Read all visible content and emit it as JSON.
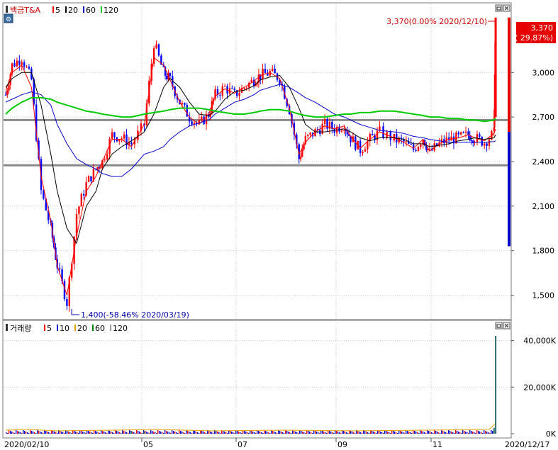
{
  "price_panel": {
    "legend": {
      "name": "백금T&A",
      "ma": [
        {
          "label": "5",
          "color": "#ff0000"
        },
        {
          "label": "20",
          "color": "#000000"
        },
        {
          "label": "60",
          "color": "#0000cc"
        },
        {
          "label": "120",
          "color": "#00cc00"
        }
      ]
    },
    "high_annotation": "3,370(0.00% 2020/12/10)",
    "low_annotation": "1,400(-58.46% 2020/03/19)",
    "current_badge": {
      "price": "3,370",
      "change": "( 29.87%)",
      "color": "#e60000"
    },
    "y_ticks": [
      "3,000",
      "2,700",
      "2,400",
      "2,100",
      "1,800",
      "1,500"
    ]
  },
  "volume_panel": {
    "legend": {
      "name": "거래량",
      "ma": [
        {
          "label": "5",
          "color": "#ff0000"
        },
        {
          "label": "10",
          "color": "#0000cc"
        },
        {
          "label": "20",
          "color": "#e6a000"
        },
        {
          "label": "60",
          "color": "#008000"
        },
        {
          "label": "120",
          "color": "#999999"
        }
      ]
    },
    "y_ticks": [
      "40,000K",
      "20,000K",
      "0K"
    ]
  },
  "x_labels": [
    "2020/02/10",
    "05",
    "07",
    "09",
    "11",
    "2020/12/17"
  ],
  "chart_data": {
    "type": "candlestick",
    "symbol": "백금T&A",
    "period": [
      "2020/02/10",
      "2020/12/17"
    ],
    "y_range": [
      1350,
      3450
    ],
    "y_ticks": [
      3000,
      2700,
      2400,
      2100,
      1800,
      1500
    ],
    "horizontal_lines": [
      2680,
      2375
    ],
    "annotations": {
      "high": {
        "price": 3370,
        "pct": 0.0,
        "date": "2020/12/10"
      },
      "low": {
        "price": 1400,
        "pct": -58.46,
        "date": "2020/03/19"
      }
    },
    "close_series": {
      "dates": [
        "2020/02/10",
        "2020/02/14",
        "2020/02/20",
        "2020/02/26",
        "2020/03/03",
        "2020/03/09",
        "2020/03/13",
        "2020/03/19",
        "2020/03/25",
        "2020/03/31",
        "2020/04/06",
        "2020/04/10",
        "2020/04/16",
        "2020/04/22",
        "2020/04/28",
        "2020/05/06",
        "2020/05/12",
        "2020/05/18",
        "2020/05/22",
        "2020/05/28",
        "2020/06/03",
        "2020/06/09",
        "2020/06/15",
        "2020/06/19",
        "2020/06/25",
        "2020/07/01",
        "2020/07/07",
        "2020/07/13",
        "2020/07/17",
        "2020/07/23",
        "2020/07/29",
        "2020/08/04",
        "2020/08/10",
        "2020/08/14",
        "2020/08/20",
        "2020/08/26",
        "2020/09/01",
        "2020/09/07",
        "2020/09/11",
        "2020/09/17",
        "2020/09/23",
        "2020/09/29",
        "2020/10/08",
        "2020/10/14",
        "2020/10/20",
        "2020/10/26",
        "2020/10/30",
        "2020/11/05",
        "2020/11/11",
        "2020/11/17",
        "2020/11/23",
        "2020/11/27",
        "2020/12/03",
        "2020/12/09",
        "2020/12/10"
      ],
      "close": [
        2850,
        3050,
        3100,
        2950,
        2200,
        1950,
        1700,
        1450,
        2050,
        2250,
        2350,
        2400,
        2580,
        2560,
        2520,
        2650,
        3200,
        3000,
        2950,
        2800,
        2700,
        2650,
        2720,
        2850,
        2900,
        2850,
        2900,
        2950,
        2980,
        3000,
        2960,
        2750,
        2420,
        2550,
        2600,
        2650,
        2620,
        2650,
        2560,
        2480,
        2550,
        2600,
        2550,
        2530,
        2480,
        2560,
        2460,
        2520,
        2550,
        2560,
        2580,
        2560,
        2530,
        2590,
        3370
      ]
    },
    "moving_averages": [
      {
        "name": "5",
        "color": "#ff0000",
        "values": [
          2880,
          3000,
          3050,
          2900,
          2300,
          2000,
          1700,
          1500,
          1900,
          2200,
          2300,
          2400,
          2550,
          2550,
          2500,
          2650,
          3100,
          3050,
          2950,
          2800,
          2700,
          2650,
          2720,
          2840,
          2890,
          2860,
          2900,
          2940,
          2980,
          3000,
          2960,
          2760,
          2450,
          2530,
          2600,
          2640,
          2620,
          2640,
          2570,
          2490,
          2550,
          2600,
          2560,
          2530,
          2490,
          2550,
          2470,
          2520,
          2550,
          2560,
          2580,
          2560,
          2540,
          2590,
          2620
        ]
      },
      {
        "name": "20",
        "color": "#000000",
        "values": [
          2900,
          2960,
          3000,
          3000,
          2780,
          2450,
          2200,
          1950,
          1850,
          2100,
          2200,
          2350,
          2450,
          2500,
          2540,
          2600,
          2720,
          2900,
          2960,
          2900,
          2800,
          2720,
          2710,
          2740,
          2820,
          2870,
          2880,
          2910,
          2950,
          2970,
          2980,
          2900,
          2760,
          2650,
          2600,
          2600,
          2610,
          2620,
          2600,
          2560,
          2540,
          2560,
          2560,
          2550,
          2520,
          2520,
          2500,
          2510,
          2520,
          2540,
          2550,
          2560,
          2550,
          2560,
          2580
        ]
      },
      {
        "name": "60",
        "color": "#0000cc",
        "values": [
          2800,
          2820,
          2850,
          2870,
          2850,
          2780,
          2650,
          2520,
          2420,
          2380,
          2350,
          2320,
          2300,
          2300,
          2350,
          2450,
          2470,
          2500,
          2550,
          2600,
          2640,
          2660,
          2680,
          2720,
          2760,
          2800,
          2820,
          2850,
          2880,
          2900,
          2920,
          2900,
          2860,
          2830,
          2800,
          2760,
          2720,
          2700,
          2680,
          2650,
          2630,
          2610,
          2600,
          2590,
          2570,
          2560,
          2550,
          2540,
          2530,
          2530,
          2530,
          2530,
          2530,
          2535,
          2540
        ]
      },
      {
        "name": "120",
        "color": "#00cc00",
        "values": [
          2720,
          2760,
          2800,
          2830,
          2830,
          2820,
          2800,
          2780,
          2760,
          2740,
          2730,
          2720,
          2710,
          2700,
          2700,
          2720,
          2730,
          2740,
          2750,
          2760,
          2760,
          2760,
          2750,
          2740,
          2730,
          2720,
          2720,
          2730,
          2740,
          2750,
          2750,
          2740,
          2720,
          2710,
          2700,
          2700,
          2710,
          2720,
          2720,
          2730,
          2730,
          2740,
          2740,
          2730,
          2720,
          2710,
          2700,
          2700,
          2690,
          2690,
          2680,
          2680,
          2670,
          2680,
          2690
        ]
      }
    ],
    "volume": {
      "unit": "K",
      "y_range": [
        0,
        42000
      ],
      "spikes": [
        {
          "date": "2020/12/10",
          "value": 42000
        },
        {
          "date": "2020/12/09",
          "value": 2500
        },
        {
          "date": "2020/04/28",
          "value": 1200
        },
        {
          "date": "2020/05/06",
          "value": 1000
        }
      ]
    },
    "right_bar": {
      "from": 3370,
      "to": 1830
    }
  }
}
